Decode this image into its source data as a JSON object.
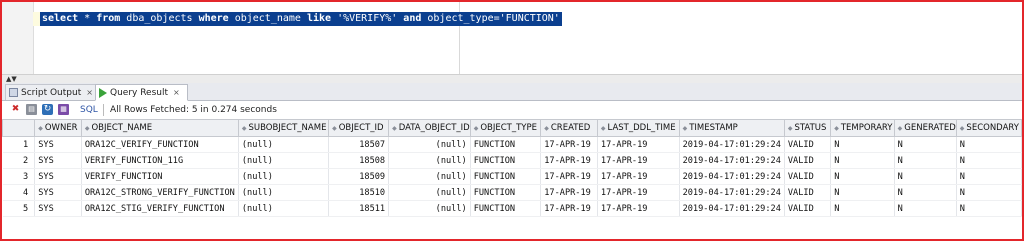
{
  "editor": {
    "sql_parts": {
      "kw_select": "select",
      "star": " * ",
      "kw_from": "from",
      "table": " dba_objects ",
      "kw_where": "where",
      "cond1": " object_name ",
      "kw_like": "like",
      "pattern": " '%VERIFY%' ",
      "kw_and": "and",
      "cond2": " object_type='FUNCTION'"
    }
  },
  "tabs": {
    "script_output": "Script Output",
    "query_result": "Query Result",
    "close_glyph": "×"
  },
  "toolbar": {
    "sql_label": "SQL",
    "status": "All Rows Fetched: 5 in 0.274 seconds"
  },
  "grid": {
    "columns": [
      "OWNER",
      "OBJECT_NAME",
      "SUBOBJECT_NAME",
      "OBJECT_ID",
      "DATA_OBJECT_ID",
      "OBJECT_TYPE",
      "CREATED",
      "LAST_DDL_TIME",
      "TIMESTAMP",
      "STATUS",
      "TEMPORARY",
      "GENERATED",
      "SECONDARY"
    ],
    "rows": [
      {
        "n": "1",
        "owner": "SYS",
        "object_name": "ORA12C_VERIFY_FUNCTION",
        "subobject_name": "(null)",
        "object_id": "18507",
        "data_object_id": "(null)",
        "object_type": "FUNCTION",
        "created": "17-APR-19",
        "last_ddl_time": "17-APR-19",
        "timestamp": "2019-04-17:01:29:24",
        "status": "VALID",
        "temporary": "N",
        "generated": "N",
        "secondary": "N"
      },
      {
        "n": "2",
        "owner": "SYS",
        "object_name": "VERIFY_FUNCTION_11G",
        "subobject_name": "(null)",
        "object_id": "18508",
        "data_object_id": "(null)",
        "object_type": "FUNCTION",
        "created": "17-APR-19",
        "last_ddl_time": "17-APR-19",
        "timestamp": "2019-04-17:01:29:24",
        "status": "VALID",
        "temporary": "N",
        "generated": "N",
        "secondary": "N"
      },
      {
        "n": "3",
        "owner": "SYS",
        "object_name": "VERIFY_FUNCTION",
        "subobject_name": "(null)",
        "object_id": "18509",
        "data_object_id": "(null)",
        "object_type": "FUNCTION",
        "created": "17-APR-19",
        "last_ddl_time": "17-APR-19",
        "timestamp": "2019-04-17:01:29:24",
        "status": "VALID",
        "temporary": "N",
        "generated": "N",
        "secondary": "N"
      },
      {
        "n": "4",
        "owner": "SYS",
        "object_name": "ORA12C_STRONG_VERIFY_FUNCTION",
        "subobject_name": "(null)",
        "object_id": "18510",
        "data_object_id": "(null)",
        "object_type": "FUNCTION",
        "created": "17-APR-19",
        "last_ddl_time": "17-APR-19",
        "timestamp": "2019-04-17:01:29:24",
        "status": "VALID",
        "temporary": "N",
        "generated": "N",
        "secondary": "N"
      },
      {
        "n": "5",
        "owner": "SYS",
        "object_name": "ORA12C_STIG_VERIFY_FUNCTION",
        "subobject_name": "(null)",
        "object_id": "18511",
        "data_object_id": "(null)",
        "object_type": "FUNCTION",
        "created": "17-APR-19",
        "last_ddl_time": "17-APR-19",
        "timestamp": "2019-04-17:01:29:24",
        "status": "VALID",
        "temporary": "N",
        "generated": "N",
        "secondary": "N"
      }
    ]
  },
  "icons": [
    "pin-icon",
    "print-icon",
    "refresh-icon",
    "export-icon",
    "script-output-icon",
    "run-play-icon",
    "sort-icon"
  ],
  "colors": {
    "frame_border": "#e3262b",
    "selection": "#0b3f8f",
    "current_line": "#fdfbdf",
    "run_icon": "#3aa33a"
  }
}
